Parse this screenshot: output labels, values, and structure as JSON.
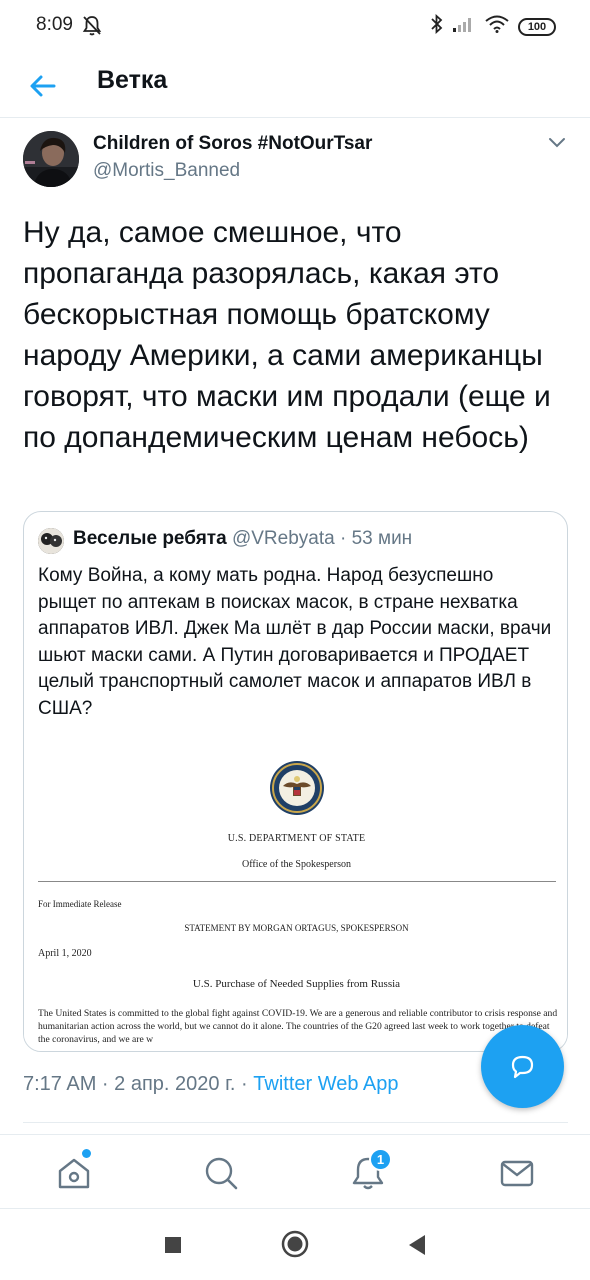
{
  "status_bar": {
    "time": "8:09",
    "battery": "100"
  },
  "header": {
    "title": "Ветка"
  },
  "tweet": {
    "author_name": "Children of Soros #NotOurTsar",
    "author_handle": "@Mortis_Banned",
    "text": "Ну да, самое смешное, что пропаганда разорялась, какая это бескорыстная помощь братскому народу Америки, а сами американцы говорят, что маски им продали (еще и по допандемическим ценам небось)",
    "time": "7:17 AM · 2 апр. 2020 г. · ",
    "source": "Twitter Web App"
  },
  "quoted_tweet": {
    "author_name": "Веселые ребята",
    "author_handle": "@VRebyata",
    "time_ago": " · 53 мин",
    "text": "Кому Война, а кому мать родна. Народ безуспешно рыщет по аптекам в поисках масок, в стране нехватка аппаратов ИВЛ. Джек Ма шлёт в дар России маски, врачи шьют маски сами. А Путин договаривается и ПРОДАЕТ целый транспортный самолет масок и аппаратов ИВЛ в США?",
    "document": {
      "department": "U.S. DEPARTMENT OF STATE",
      "office": "Office of the Spokesperson",
      "release": "For Immediate Release",
      "statement": "STATEMENT BY MORGAN ORTAGUS, SPOKESPERSON",
      "date": "April 1, 2020",
      "subject": "U.S. Purchase of Needed Supplies from Russia",
      "body": "The United States is committed to the global fight against COVID-19. We are a generous and reliable contributor to crisis response and humanitarian action across the world, but we cannot do it alone. The countries of the G20 agreed last week to work together to defeat the coronavirus, and we are w"
    }
  },
  "bottom_nav": {
    "notifications_count": "1"
  },
  "icons": {
    "back": "arrow-left-icon",
    "caret": "chevron-down-icon",
    "fab": "compose-reply-icon",
    "home": "home-icon",
    "search": "search-icon",
    "notifications": "bell-icon",
    "messages": "mail-icon"
  },
  "colors": {
    "accent": "#1da1f2",
    "secondary_text": "#657786",
    "divider": "#e6ecf0"
  }
}
